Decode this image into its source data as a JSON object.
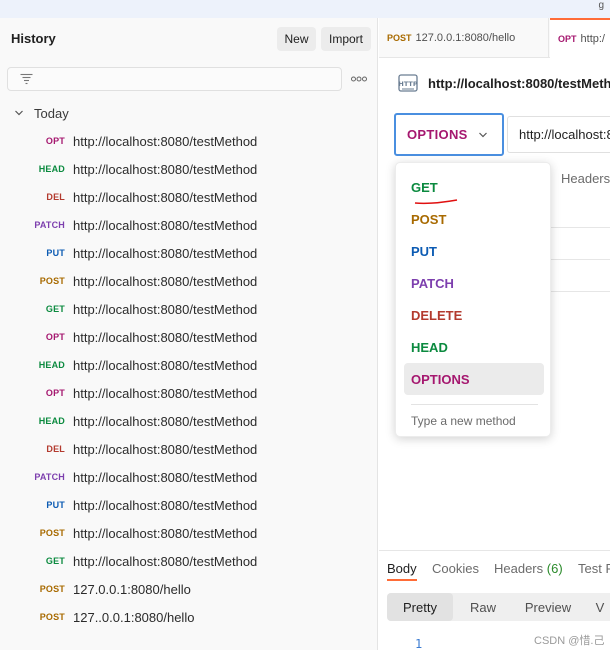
{
  "top_fragment": "g",
  "sidebar": {
    "title": "History",
    "new_label": "New",
    "import_label": "Import",
    "group_label": "Today",
    "items": [
      {
        "method": "OPT",
        "url": "http://localhost:8080/testMethod",
        "color": "#a5176f"
      },
      {
        "method": "HEAD",
        "url": "http://localhost:8080/testMethod",
        "color": "#0b8a3f"
      },
      {
        "method": "DEL",
        "url": "http://localhost:8080/testMethod",
        "color": "#b33a2e"
      },
      {
        "method": "PATCH",
        "url": "http://localhost:8080/testMethod",
        "color": "#7d3fae"
      },
      {
        "method": "PUT",
        "url": "http://localhost:8080/testMethod",
        "color": "#0c5bb3"
      },
      {
        "method": "POST",
        "url": "http://localhost:8080/testMethod",
        "color": "#a86a00"
      },
      {
        "method": "GET",
        "url": "http://localhost:8080/testMethod",
        "color": "#0b8a3f"
      },
      {
        "method": "OPT",
        "url": "http://localhost:8080/testMethod",
        "color": "#a5176f"
      },
      {
        "method": "HEAD",
        "url": "http://localhost:8080/testMethod",
        "color": "#0b8a3f"
      },
      {
        "method": "OPT",
        "url": "http://localhost:8080/testMethod",
        "color": "#a5176f"
      },
      {
        "method": "HEAD",
        "url": "http://localhost:8080/testMethod",
        "color": "#0b8a3f"
      },
      {
        "method": "DEL",
        "url": "http://localhost:8080/testMethod",
        "color": "#b33a2e"
      },
      {
        "method": "PATCH",
        "url": "http://localhost:8080/testMethod",
        "color": "#7d3fae"
      },
      {
        "method": "PUT",
        "url": "http://localhost:8080/testMethod",
        "color": "#0c5bb3"
      },
      {
        "method": "POST",
        "url": "http://localhost:8080/testMethod",
        "color": "#a86a00"
      },
      {
        "method": "GET",
        "url": "http://localhost:8080/testMethod",
        "color": "#0b8a3f"
      },
      {
        "method": "POST",
        "url": "127.0.0.1:8080/hello",
        "color": "#a86a00"
      },
      {
        "method": "POST",
        "url": "127..0.0.1:8080/hello",
        "color": "#a86a00"
      }
    ]
  },
  "tabs": [
    {
      "method": "POST",
      "url": "127.0.0.1:8080/hello",
      "color": "#a86a00"
    },
    {
      "method": "OPT",
      "url": "http:/",
      "color": "#a5176f"
    }
  ],
  "request": {
    "title": "http://localhost:8080/testMeth",
    "method": "OPTIONS",
    "url": "http://localhost:8",
    "headers_tab": "Headers"
  },
  "dropdown": {
    "options": [
      {
        "label": "GET",
        "color": "#0b8a3f"
      },
      {
        "label": "POST",
        "color": "#a86a00"
      },
      {
        "label": "PUT",
        "color": "#0c5bb3"
      },
      {
        "label": "PATCH",
        "color": "#7d3fae"
      },
      {
        "label": "DELETE",
        "color": "#b33a2e"
      },
      {
        "label": "HEAD",
        "color": "#0b8a3f"
      },
      {
        "label": "OPTIONS",
        "color": "#a5176f"
      }
    ],
    "selected": "OPTIONS",
    "type_placeholder": "Type a new method"
  },
  "response": {
    "tabs": {
      "body": "Body",
      "cookies": "Cookies",
      "headers": "Headers",
      "headers_count": "(6)",
      "test": "Test R"
    },
    "views": [
      "Pretty",
      "Raw",
      "Preview",
      "V"
    ],
    "line_number": "1"
  },
  "watermark": "CSDN @惜.己"
}
